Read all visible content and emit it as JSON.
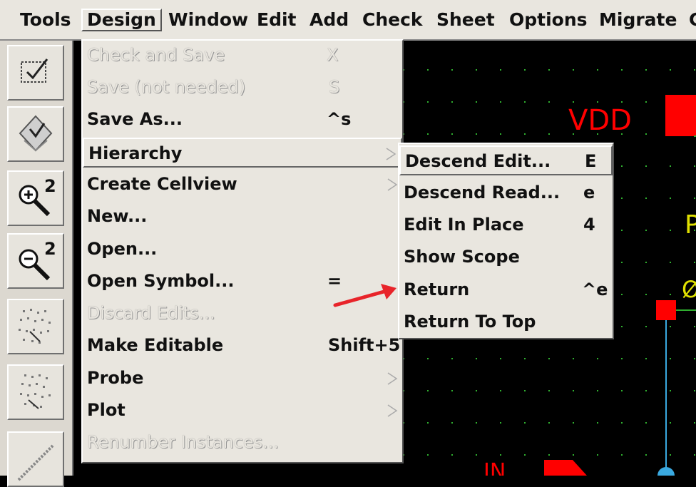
{
  "menubar": {
    "items": [
      "Tools",
      "Design",
      "Window",
      "Edit",
      "Add",
      "Check",
      "Sheet",
      "Options",
      "Migrate",
      "C"
    ]
  },
  "design_menu": {
    "items": [
      {
        "label": "Check and Save",
        "accel": "X",
        "disabled": true
      },
      {
        "label": "Save (not needed)",
        "accel": "S",
        "disabled": true
      },
      {
        "label": "Save As...",
        "accel": "^s",
        "disabled": false
      },
      {
        "label": "Hierarchy",
        "accel": "",
        "disabled": false,
        "submenu": true
      },
      {
        "label": "Create Cellview",
        "accel": "",
        "disabled": false,
        "submenu": true
      },
      {
        "label": "New...",
        "accel": "",
        "disabled": false
      },
      {
        "label": "Open...",
        "accel": "",
        "disabled": false
      },
      {
        "label": "Open Symbol...",
        "accel": "=",
        "disabled": false
      },
      {
        "label": "Discard Edits...",
        "accel": "",
        "disabled": true
      },
      {
        "label": "Make Editable",
        "accel": "Shift+5",
        "disabled": false
      },
      {
        "label": "Probe",
        "accel": "",
        "disabled": false,
        "submenu": true
      },
      {
        "label": "Plot",
        "accel": "",
        "disabled": false,
        "submenu": true
      },
      {
        "label": "Renumber Instances...",
        "accel": "",
        "disabled": true
      }
    ]
  },
  "hierarchy_menu": {
    "items": [
      {
        "label": "Descend Edit...",
        "accel": "E"
      },
      {
        "label": "Descend Read...",
        "accel": "e"
      },
      {
        "label": "Edit In Place",
        "accel": "4"
      },
      {
        "label": "Show Scope",
        "accel": ""
      },
      {
        "label": "Return",
        "accel": "^e"
      },
      {
        "label": "Return To Top",
        "accel": ""
      }
    ]
  },
  "canvas": {
    "labels": {
      "vdd": "VDD",
      "p": "P",
      "zero": "Ø",
      "in": "IN"
    }
  },
  "toolbar": {
    "icons": [
      "check-and-save-icon",
      "save-icon",
      "zoom-in-2-icon",
      "zoom-out-2-icon",
      "stretch-icon",
      "copy-icon",
      "wire-icon"
    ],
    "zoom_in_factor": "2",
    "zoom_out_factor": "2"
  },
  "colors": {
    "canvas_bg": "#000000",
    "grid_dot": "#2fae2f",
    "pin_red": "#ff0000",
    "wire_blue": "#3aa9e0",
    "annotation_arrow": "#e8242a",
    "menu_bg": "#e9e6df"
  }
}
